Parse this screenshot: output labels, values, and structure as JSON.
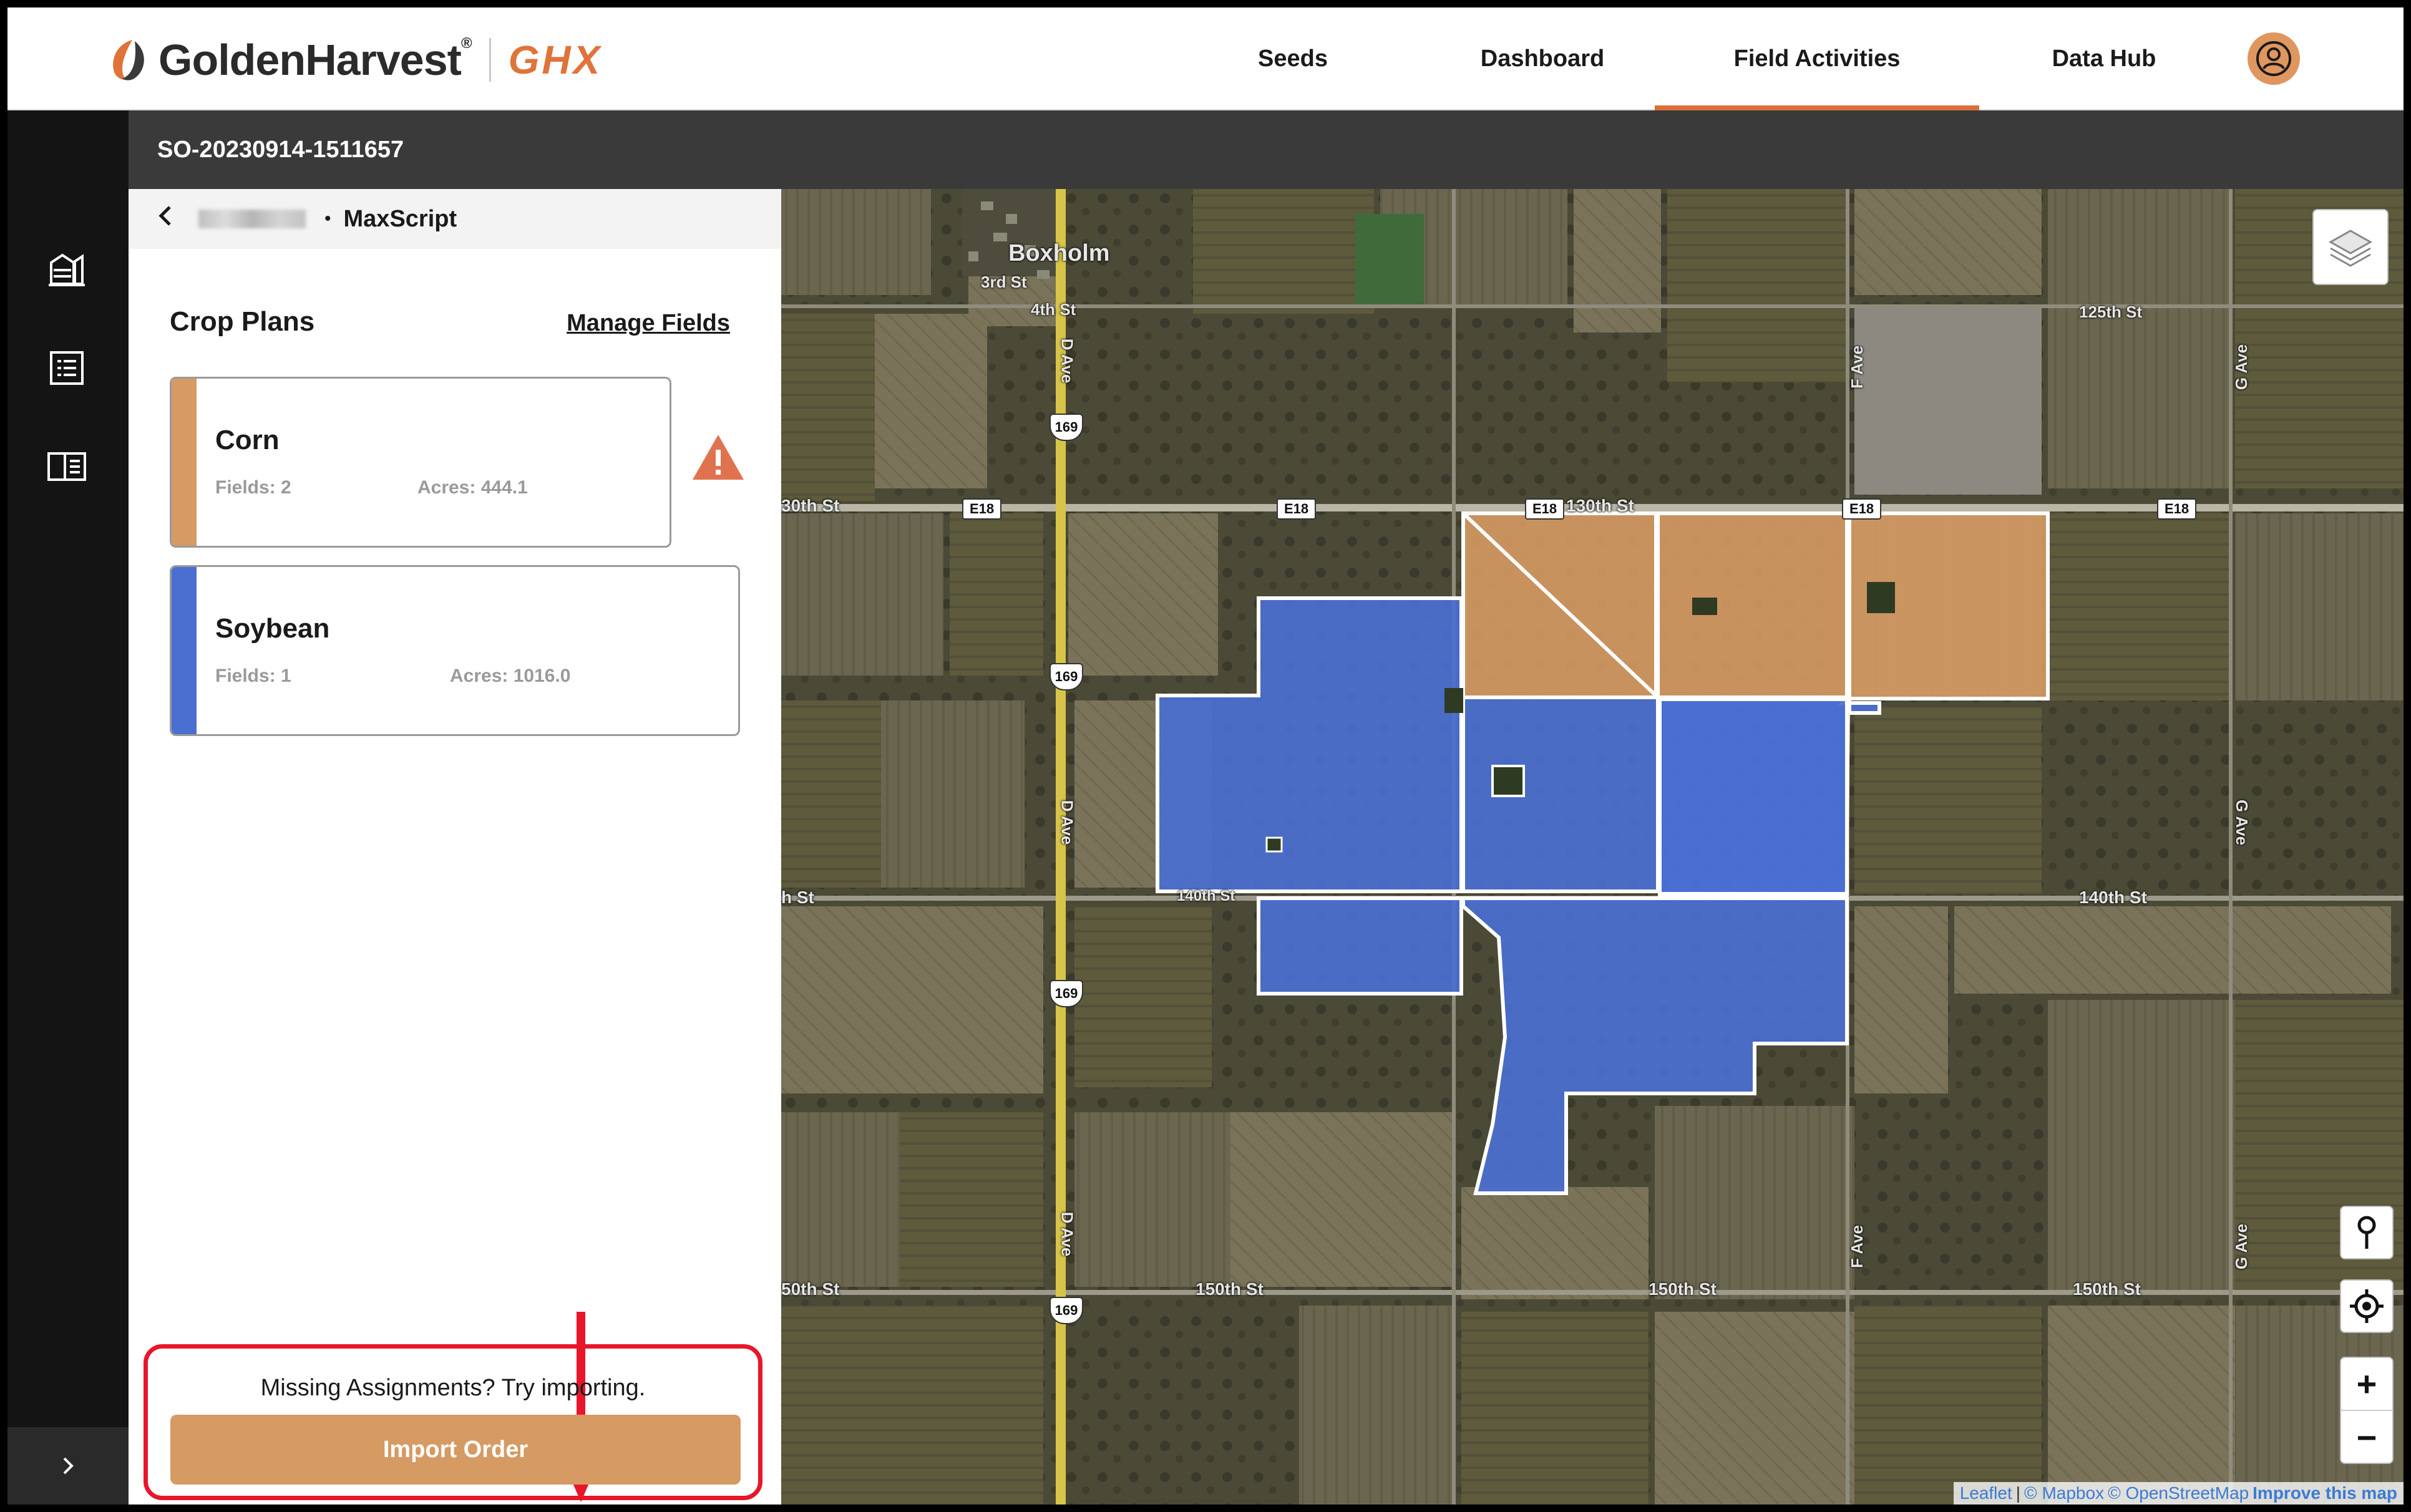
{
  "header": {
    "brand_name": "GoldenHarvest",
    "brand_reg": "®",
    "brand_sub": "GHX",
    "nav": {
      "seeds": "Seeds",
      "dashboard": "Dashboard",
      "field_activities": "Field Activities",
      "data_hub": "Data Hub"
    },
    "active_nav": "Field Activities"
  },
  "order_bar": {
    "order_id": "SO-20230914-1511657"
  },
  "panel": {
    "breadcrumb": {
      "separator": "•",
      "current": "MaxScript"
    },
    "crop_plans_title": "Crop Plans",
    "manage_fields": "Manage Fields",
    "crops": [
      {
        "name": "Corn",
        "fields": "Fields: 2",
        "acres": "Acres: 444.1",
        "color": "#d69a63",
        "warning": true
      },
      {
        "name": "Soybean",
        "fields": "Fields: 1",
        "acres": "Acres: 1016.0",
        "color": "#4a6fd1",
        "warning": false
      }
    ],
    "import_hint": "Missing Assignments? Try importing.",
    "import_button": "Import Order"
  },
  "map": {
    "labels": {
      "town": "Boxholm",
      "third_st": "3rd St",
      "fourth_st": "4th St",
      "d_ave": "D Ave",
      "f_ave": "F Ave",
      "g_ave": "G Ave",
      "st_125": "125th St",
      "st_130": "130th St",
      "st_130_left": "30th St",
      "st_140": "140th St",
      "st_140_left": "h St",
      "st_140_mid": "140th St",
      "st_150": "150th St",
      "st_150_left": "50th St",
      "route_e18": "E18",
      "hwy_169": "169"
    },
    "attribution": {
      "leaflet": "Leaflet",
      "sep": "|",
      "mapbox": "© Mapbox",
      "osm": "© OpenStreetMap",
      "improve": "Improve this map"
    },
    "corn_color": "#d69a63",
    "soy_color": "#4a6fd1",
    "controls": [
      "layers-icon",
      "pin-icon",
      "locate-icon",
      "zoom-in",
      "zoom-out"
    ]
  },
  "controls": {
    "zoom_in": "+",
    "zoom_out": "−"
  },
  "annotation_color": "#e8162a"
}
